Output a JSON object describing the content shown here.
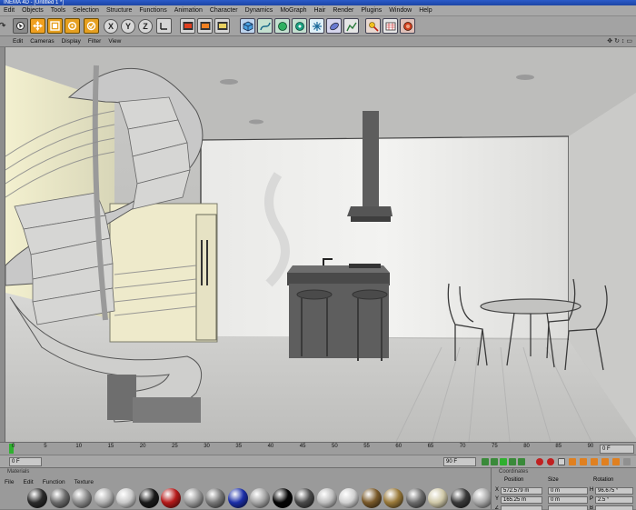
{
  "window": {
    "title": "INEMA 4D - [Untitled 1 *]"
  },
  "menu": [
    "Edit",
    "Objects",
    "Tools",
    "Selection",
    "Structure",
    "Functions",
    "Animation",
    "Character",
    "Dynamics",
    "MoGraph",
    "Hair",
    "Render",
    "Plugins",
    "Window",
    "Help"
  ],
  "toolbar": {
    "axis_x": "X",
    "axis_y": "Y",
    "axis_z": "Z"
  },
  "viewport_menu": [
    "Edit",
    "Cameras",
    "Display",
    "Filter",
    "View"
  ],
  "timeline": {
    "ticks": [
      "0",
      "5",
      "10",
      "15",
      "20",
      "25",
      "30",
      "35",
      "40",
      "45",
      "50",
      "55",
      "60",
      "65",
      "70",
      "75",
      "80",
      "85",
      "90"
    ],
    "current_frame": "0 F",
    "right_frame": "0 F"
  },
  "playbar": {
    "start": "0 F",
    "end": "90 F"
  },
  "materials": {
    "title": "Materials",
    "menu": [
      "File",
      "Edit",
      "Function",
      "Texture"
    ],
    "swatch_colors": [
      "#2b2b2b",
      "#6a6a6a",
      "#8a8a8a",
      "#b0b0b0",
      "#c9c9c9",
      "#1a1a1a",
      "#b51a1a",
      "#9a9a9a",
      "#777777",
      "#1c2fa8",
      "#a5a5a5",
      "#050505",
      "#4a4a4a",
      "#bdbdbd",
      "#d0d0d0",
      "#7a5a2a",
      "#9a7a3a",
      "#6c6c6c",
      "#cfc8a8",
      "#3a3a3a",
      "#a8a8a8",
      "#5a5a5a"
    ]
  },
  "coordinates": {
    "title": "Coordinates",
    "headers": [
      "Position",
      "Size",
      "Rotation"
    ],
    "rows": [
      {
        "axis": "X",
        "position": "572.579 m",
        "size": "0 m",
        "rot_label": "H",
        "rotation": "96.675 °"
      },
      {
        "axis": "Y",
        "position": "165.25 m",
        "size": "0 m",
        "rot_label": "P",
        "rotation": "2.5 °"
      },
      {
        "axis": "Z",
        "position": "",
        "size": "",
        "rot_label": "B",
        "rotation": ""
      }
    ]
  }
}
